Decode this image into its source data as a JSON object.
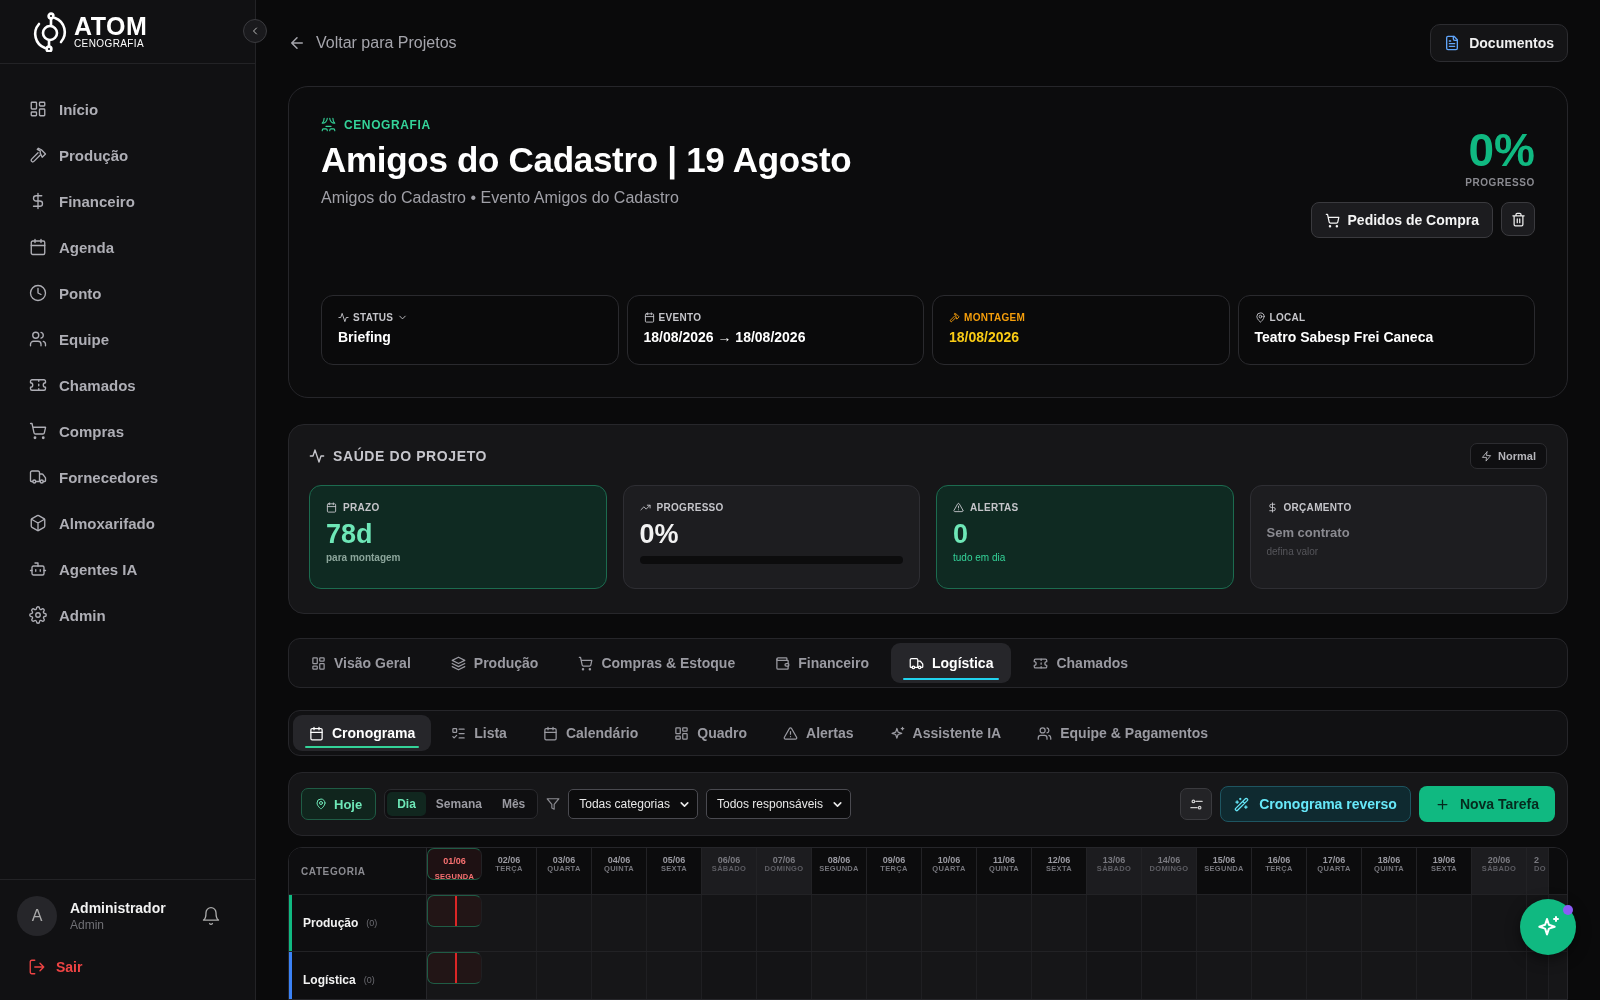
{
  "sidebar": {
    "logo": {
      "name": "ATOM",
      "tagline": "CENOGRAFIA"
    },
    "items": [
      {
        "label": "Início"
      },
      {
        "label": "Produção"
      },
      {
        "label": "Financeiro"
      },
      {
        "label": "Agenda"
      },
      {
        "label": "Ponto"
      },
      {
        "label": "Equipe"
      },
      {
        "label": "Chamados"
      },
      {
        "label": "Compras"
      },
      {
        "label": "Fornecedores"
      },
      {
        "label": "Almoxarifado"
      },
      {
        "label": "Agentes IA"
      },
      {
        "label": "Admin"
      }
    ],
    "user": {
      "initial": "A",
      "name": "Administrador",
      "role": "Admin"
    },
    "logout": "Sair"
  },
  "header": {
    "back": "Voltar para Projetos",
    "documents": "Documentos"
  },
  "project": {
    "category": "CENOGRAFIA",
    "title": "Amigos do Cadastro | 19 Agosto",
    "subtitle": "Amigos do Cadastro • Evento Amigos do Cadastro",
    "progress": "0%",
    "progress_label": "PROGRESSO",
    "purchase_button": "Pedidos de Compra",
    "info": [
      {
        "kind": "status",
        "label": "STATUS",
        "value": "Briefing"
      },
      {
        "kind": "event",
        "label": "EVENTO",
        "value": "18/08/2026 → 18/08/2026"
      },
      {
        "kind": "assembly",
        "label": "MONTAGEM",
        "value": "18/08/2026"
      },
      {
        "kind": "location",
        "label": "LOCAL",
        "value": "Teatro Sabesp Frei Caneca"
      }
    ]
  },
  "health": {
    "title": "SAÚDE DO PROJETO",
    "mode": "Normal",
    "cards": [
      {
        "kind": "deadline",
        "highlighted": true,
        "label": "PRAZO",
        "value": "78d",
        "note": "para montagem"
      },
      {
        "kind": "progress",
        "highlighted": false,
        "label": "PROGRESSO",
        "value": "0%",
        "level": 0
      },
      {
        "kind": "alerts",
        "highlighted": true,
        "label": "ALERTAS",
        "value": "0",
        "note": "tudo em dia"
      },
      {
        "kind": "budget",
        "highlighted": false,
        "label": "ORÇAMENTO",
        "value": "Sem contrato",
        "note": "defina valor"
      }
    ]
  },
  "tabs": [
    {
      "label": "Visão Geral",
      "selected": false
    },
    {
      "label": "Produção",
      "selected": false
    },
    {
      "label": "Compras & Estoque",
      "selected": false
    },
    {
      "label": "Financeiro",
      "selected": false
    },
    {
      "label": "Logística",
      "selected": true
    },
    {
      "label": "Chamados",
      "selected": false
    }
  ],
  "subtabs": [
    {
      "label": "Cronograma",
      "selected": true
    },
    {
      "label": "Lista",
      "selected": false
    },
    {
      "label": "Calendário",
      "selected": false
    },
    {
      "label": "Quadro",
      "selected": false
    },
    {
      "label": "Alertas",
      "selected": false
    },
    {
      "label": "Assistente IA",
      "selected": false
    },
    {
      "label": "Equipe & Pagamentos",
      "selected": false
    }
  ],
  "toolbar": {
    "today": "Hoje",
    "views": [
      {
        "label": "Dia",
        "selected": true
      },
      {
        "label": "Semana",
        "selected": false
      },
      {
        "label": "Mês",
        "selected": false
      }
    ],
    "category_filter": "Todas categorias",
    "owner_filter": "Todos responsáveis",
    "reverse": "Cronograma reverso",
    "new_task": "Nova Tarefa"
  },
  "gantt": {
    "category_header": "CATEGORIA",
    "days": [
      {
        "date": "01/06",
        "weekday": "SEGUNDA",
        "today": true,
        "weekend": false
      },
      {
        "date": "02/06",
        "weekday": "TERÇA",
        "today": false,
        "weekend": false
      },
      {
        "date": "03/06",
        "weekday": "QUARTA",
        "today": false,
        "weekend": false
      },
      {
        "date": "04/06",
        "weekday": "QUINTA",
        "today": false,
        "weekend": false
      },
      {
        "date": "05/06",
        "weekday": "SEXTA",
        "today": false,
        "weekend": false
      },
      {
        "date": "06/06",
        "weekday": "SÁBADO",
        "today": false,
        "weekend": true
      },
      {
        "date": "07/06",
        "weekday": "DOMINGO",
        "today": false,
        "weekend": true
      },
      {
        "date": "08/06",
        "weekday": "SEGUNDA",
        "today": false,
        "weekend": false
      },
      {
        "date": "09/06",
        "weekday": "TERÇA",
        "today": false,
        "weekend": false
      },
      {
        "date": "10/06",
        "weekday": "QUARTA",
        "today": false,
        "weekend": false
      },
      {
        "date": "11/06",
        "weekday": "QUINTA",
        "today": false,
        "weekend": false
      },
      {
        "date": "12/06",
        "weekday": "SEXTA",
        "today": false,
        "weekend": false
      },
      {
        "date": "13/06",
        "weekday": "SÁBADO",
        "today": false,
        "weekend": true
      },
      {
        "date": "14/06",
        "weekday": "DOMINGO",
        "today": false,
        "weekend": true
      },
      {
        "date": "15/06",
        "weekday": "SEGUNDA",
        "today": false,
        "weekend": false
      },
      {
        "date": "16/06",
        "weekday": "TERÇA",
        "today": false,
        "weekend": false
      },
      {
        "date": "17/06",
        "weekday": "QUARTA",
        "today": false,
        "weekend": false
      },
      {
        "date": "18/06",
        "weekday": "QUINTA",
        "today": false,
        "weekend": false
      },
      {
        "date": "19/06",
        "weekday": "SEXTA",
        "today": false,
        "weekend": false
      },
      {
        "date": "20/06",
        "weekday": "SÁBADO",
        "today": false,
        "weekend": true
      },
      {
        "date": "2",
        "weekday": "DO",
        "today": false,
        "weekend": true
      }
    ],
    "rows": [
      {
        "name": "Produção",
        "count": "(0)",
        "color": "#10b981"
      },
      {
        "name": "Logística",
        "count": "(0)",
        "color": "#3b82f6"
      }
    ]
  }
}
